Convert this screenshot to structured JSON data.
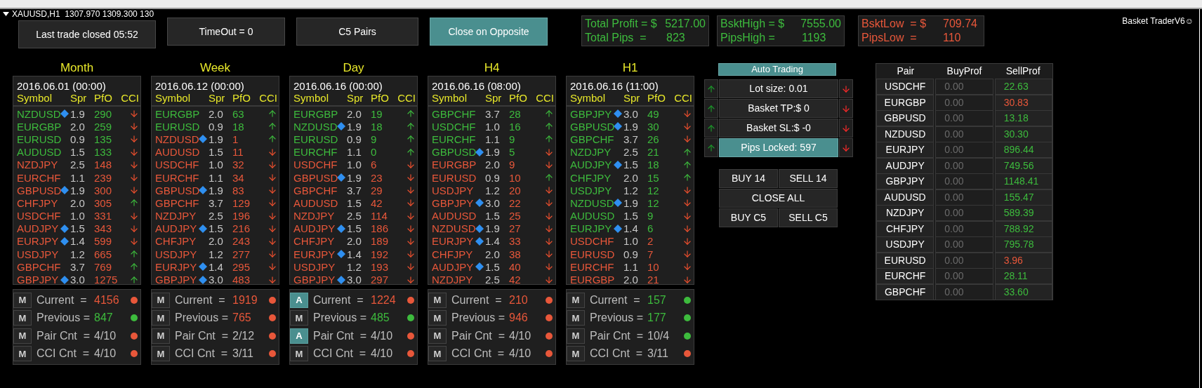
{
  "chart_header": "XAUUSD,H1  1307.970 1309.300 130",
  "top_buttons": [
    {
      "label": "Last trade closed 05:52",
      "selected": false
    },
    {
      "label": "TimeOut = 0",
      "selected": false
    },
    {
      "label": "C5 Pairs",
      "selected": false
    },
    {
      "label": "Close on Opposite",
      "selected": true
    }
  ],
  "summary_boxes": [
    {
      "color": "#3dbb3d",
      "lines": [
        {
          "label": "Total Profit = $",
          "value": "5217.00"
        },
        {
          "label": "Total Pips  =",
          "value": "823"
        }
      ]
    },
    {
      "color": "#3dbb3d",
      "lines": [
        {
          "label": "BsktHigh = $",
          "value": "7555.00"
        },
        {
          "label": "PipsHigh =",
          "value": "1193"
        }
      ]
    },
    {
      "color": "#e8573a",
      "lines": [
        {
          "label": "BsktLow  = $",
          "value": "709.74"
        },
        {
          "label": "PipsLow  =",
          "value": "110"
        }
      ]
    }
  ],
  "brand": "Basket TraderV6☺",
  "panels": [
    {
      "title": "Month",
      "date": "2016.06.01 (00:00)",
      "columns": [
        "Symbol",
        "Spr",
        "PfO",
        "CCI"
      ],
      "rows": [
        {
          "symbol": "NZDUSD",
          "marked": true,
          "spr": "1.9",
          "pfo": "290",
          "cci_up": false,
          "color": "#3dbb3d"
        },
        {
          "symbol": "EURGBP",
          "marked": false,
          "spr": "2.0",
          "pfo": "259",
          "cci_up": false,
          "color": "#3dbb3d"
        },
        {
          "symbol": "EURUSD",
          "marked": false,
          "spr": "0.9",
          "pfo": "135",
          "cci_up": false,
          "color": "#3dbb3d"
        },
        {
          "symbol": "AUDUSD",
          "marked": false,
          "spr": "1.5",
          "pfo": "133",
          "cci_up": false,
          "color": "#3dbb3d"
        },
        {
          "symbol": "NZDJPY",
          "marked": false,
          "spr": "2.5",
          "pfo": "148",
          "cci_up": false,
          "color": "#e8573a"
        },
        {
          "symbol": "EURCHF",
          "marked": false,
          "spr": "1.1",
          "pfo": "239",
          "cci_up": false,
          "color": "#e8573a"
        },
        {
          "symbol": "GBPUSD",
          "marked": true,
          "spr": "1.9",
          "pfo": "300",
          "cci_up": false,
          "color": "#e8573a"
        },
        {
          "symbol": "CHFJPY",
          "marked": false,
          "spr": "2.0",
          "pfo": "305",
          "cci_up": true,
          "color": "#e8573a"
        },
        {
          "symbol": "USDCHF",
          "marked": false,
          "spr": "1.0",
          "pfo": "331",
          "cci_up": false,
          "color": "#e8573a"
        },
        {
          "symbol": "AUDJPY",
          "marked": true,
          "spr": "1.5",
          "pfo": "343",
          "cci_up": false,
          "color": "#e8573a"
        },
        {
          "symbol": "EURJPY",
          "marked": true,
          "spr": "1.4",
          "pfo": "599",
          "cci_up": false,
          "color": "#e8573a"
        },
        {
          "symbol": "USDJPY",
          "marked": false,
          "spr": "1.2",
          "pfo": "665",
          "cci_up": true,
          "color": "#e8573a"
        },
        {
          "symbol": "GBPCHF",
          "marked": false,
          "spr": "3.7",
          "pfo": "769",
          "cci_up": true,
          "color": "#e8573a"
        },
        {
          "symbol": "GBPJPY",
          "marked": true,
          "spr": "3.0",
          "pfo": "1275",
          "cci_up": true,
          "color": "#e8573a"
        }
      ],
      "stats": [
        {
          "mode": "M",
          "active": false,
          "label": "Current  =",
          "value": "4156",
          "value_colored": true,
          "color": "#e8573a"
        },
        {
          "mode": "M",
          "active": false,
          "label": "Previous =",
          "value": "847",
          "value_colored": true,
          "color": "#3dbb3d"
        },
        {
          "mode": "M",
          "active": false,
          "label": "Pair Cnt  =",
          "value": "4/10",
          "value_colored": false,
          "color": "#e8573a"
        },
        {
          "mode": "M",
          "active": false,
          "label": "CCI Cnt  =",
          "value": "4/10",
          "value_colored": false,
          "color": "#e8573a"
        }
      ]
    },
    {
      "title": "Week",
      "date": "2016.06.12 (00:00)",
      "columns": [
        "Symbol",
        "Spr",
        "PfO",
        "CCI"
      ],
      "rows": [
        {
          "symbol": "EURGBP",
          "marked": false,
          "spr": "2.0",
          "pfo": "63",
          "cci_up": true,
          "color": "#3dbb3d"
        },
        {
          "symbol": "EURUSD",
          "marked": false,
          "spr": "0.9",
          "pfo": "18",
          "cci_up": true,
          "color": "#3dbb3d"
        },
        {
          "symbol": "NZDUSD",
          "marked": true,
          "spr": "1.9",
          "pfo": "1",
          "cci_up": true,
          "color": "#e8573a"
        },
        {
          "symbol": "AUDUSD",
          "marked": false,
          "spr": "1.5",
          "pfo": "11",
          "cci_up": false,
          "color": "#e8573a"
        },
        {
          "symbol": "USDCHF",
          "marked": false,
          "spr": "1.0",
          "pfo": "32",
          "cci_up": false,
          "color": "#e8573a"
        },
        {
          "symbol": "EURCHF",
          "marked": false,
          "spr": "1.1",
          "pfo": "34",
          "cci_up": false,
          "color": "#e8573a"
        },
        {
          "symbol": "GBPUSD",
          "marked": true,
          "spr": "1.9",
          "pfo": "83",
          "cci_up": false,
          "color": "#e8573a"
        },
        {
          "symbol": "GBPCHF",
          "marked": false,
          "spr": "3.7",
          "pfo": "129",
          "cci_up": false,
          "color": "#e8573a"
        },
        {
          "symbol": "NZDJPY",
          "marked": false,
          "spr": "2.5",
          "pfo": "196",
          "cci_up": false,
          "color": "#e8573a"
        },
        {
          "symbol": "AUDJPY",
          "marked": true,
          "spr": "1.5",
          "pfo": "216",
          "cci_up": false,
          "color": "#e8573a"
        },
        {
          "symbol": "CHFJPY",
          "marked": false,
          "spr": "2.0",
          "pfo": "243",
          "cci_up": false,
          "color": "#e8573a"
        },
        {
          "symbol": "USDJPY",
          "marked": false,
          "spr": "1.2",
          "pfo": "277",
          "cci_up": false,
          "color": "#e8573a"
        },
        {
          "symbol": "EURJPY",
          "marked": true,
          "spr": "1.4",
          "pfo": "295",
          "cci_up": false,
          "color": "#e8573a"
        },
        {
          "symbol": "GBPJPY",
          "marked": true,
          "spr": "3.0",
          "pfo": "483",
          "cci_up": false,
          "color": "#e8573a"
        }
      ],
      "stats": [
        {
          "mode": "M",
          "active": false,
          "label": "Current  =",
          "value": "1919",
          "value_colored": true,
          "color": "#e8573a"
        },
        {
          "mode": "M",
          "active": false,
          "label": "Previous =",
          "value": "765",
          "value_colored": true,
          "color": "#e8573a"
        },
        {
          "mode": "M",
          "active": false,
          "label": "Pair Cnt  =",
          "value": "2/12",
          "value_colored": false,
          "color": "#e8573a"
        },
        {
          "mode": "M",
          "active": false,
          "label": "CCI Cnt  =",
          "value": "3/11",
          "value_colored": false,
          "color": "#e8573a"
        }
      ]
    },
    {
      "title": "Day",
      "date": "2016.06.16 (00:00)",
      "columns": [
        "Symbol",
        "Spr",
        "PfO",
        "CCI"
      ],
      "rows": [
        {
          "symbol": "EURGBP",
          "marked": false,
          "spr": "2.0",
          "pfo": "19",
          "cci_up": true,
          "color": "#3dbb3d"
        },
        {
          "symbol": "NZDUSD",
          "marked": true,
          "spr": "1.9",
          "pfo": "18",
          "cci_up": true,
          "color": "#3dbb3d"
        },
        {
          "symbol": "EURUSD",
          "marked": false,
          "spr": "0.9",
          "pfo": "9",
          "cci_up": true,
          "color": "#3dbb3d"
        },
        {
          "symbol": "EURCHF",
          "marked": false,
          "spr": "1.1",
          "pfo": "0",
          "cci_up": true,
          "color": "#3dbb3d"
        },
        {
          "symbol": "USDCHF",
          "marked": false,
          "spr": "1.0",
          "pfo": "6",
          "cci_up": false,
          "color": "#e8573a"
        },
        {
          "symbol": "GBPUSD",
          "marked": true,
          "spr": "1.9",
          "pfo": "23",
          "cci_up": false,
          "color": "#e8573a"
        },
        {
          "symbol": "GBPCHF",
          "marked": false,
          "spr": "3.7",
          "pfo": "29",
          "cci_up": false,
          "color": "#e8573a"
        },
        {
          "symbol": "AUDUSD",
          "marked": false,
          "spr": "1.5",
          "pfo": "42",
          "cci_up": false,
          "color": "#e8573a"
        },
        {
          "symbol": "NZDJPY",
          "marked": false,
          "spr": "2.5",
          "pfo": "114",
          "cci_up": false,
          "color": "#e8573a"
        },
        {
          "symbol": "AUDJPY",
          "marked": true,
          "spr": "1.5",
          "pfo": "186",
          "cci_up": false,
          "color": "#e8573a"
        },
        {
          "symbol": "CHFJPY",
          "marked": false,
          "spr": "2.0",
          "pfo": "189",
          "cci_up": false,
          "color": "#e8573a"
        },
        {
          "symbol": "EURJPY",
          "marked": true,
          "spr": "1.4",
          "pfo": "192",
          "cci_up": false,
          "color": "#e8573a"
        },
        {
          "symbol": "USDJPY",
          "marked": false,
          "spr": "1.2",
          "pfo": "193",
          "cci_up": false,
          "color": "#e8573a"
        },
        {
          "symbol": "GBPJPY",
          "marked": true,
          "spr": "3.0",
          "pfo": "297",
          "cci_up": false,
          "color": "#e8573a"
        }
      ],
      "stats": [
        {
          "mode": "A",
          "active": true,
          "label": "Current  =",
          "value": "1224",
          "value_colored": true,
          "color": "#e8573a"
        },
        {
          "mode": "M",
          "active": false,
          "label": "Previous =",
          "value": "485",
          "value_colored": true,
          "color": "#3dbb3d"
        },
        {
          "mode": "A",
          "active": true,
          "label": "Pair Cnt  =",
          "value": "4/10",
          "value_colored": false,
          "color": "#e8573a"
        },
        {
          "mode": "M",
          "active": false,
          "label": "CCI Cnt  =",
          "value": "4/10",
          "value_colored": false,
          "color": "#e8573a"
        }
      ]
    },
    {
      "title": "H4",
      "date": "2016.06.16 (08:00)",
      "columns": [
        "Symbol",
        "Spr",
        "PfO",
        "CCI"
      ],
      "rows": [
        {
          "symbol": "GBPCHF",
          "marked": false,
          "spr": "3.7",
          "pfo": "28",
          "cci_up": true,
          "color": "#3dbb3d"
        },
        {
          "symbol": "USDCHF",
          "marked": false,
          "spr": "1.0",
          "pfo": "16",
          "cci_up": true,
          "color": "#3dbb3d"
        },
        {
          "symbol": "EURCHF",
          "marked": false,
          "spr": "1.1",
          "pfo": "9",
          "cci_up": true,
          "color": "#3dbb3d"
        },
        {
          "symbol": "GBPUSD",
          "marked": true,
          "spr": "1.9",
          "pfo": "5",
          "cci_up": false,
          "color": "#3dbb3d"
        },
        {
          "symbol": "EURGBP",
          "marked": false,
          "spr": "2.0",
          "pfo": "9",
          "cci_up": false,
          "color": "#e8573a"
        },
        {
          "symbol": "EURUSD",
          "marked": false,
          "spr": "0.9",
          "pfo": "10",
          "cci_up": true,
          "color": "#e8573a"
        },
        {
          "symbol": "USDJPY",
          "marked": false,
          "spr": "1.2",
          "pfo": "20",
          "cci_up": false,
          "color": "#e8573a"
        },
        {
          "symbol": "GBPJPY",
          "marked": true,
          "spr": "3.0",
          "pfo": "22",
          "cci_up": false,
          "color": "#e8573a"
        },
        {
          "symbol": "AUDUSD",
          "marked": false,
          "spr": "1.5",
          "pfo": "25",
          "cci_up": false,
          "color": "#e8573a"
        },
        {
          "symbol": "NZDUSD",
          "marked": true,
          "spr": "1.9",
          "pfo": "27",
          "cci_up": false,
          "color": "#e8573a"
        },
        {
          "symbol": "EURJPY",
          "marked": true,
          "spr": "1.4",
          "pfo": "33",
          "cci_up": false,
          "color": "#e8573a"
        },
        {
          "symbol": "CHFJPY",
          "marked": false,
          "spr": "2.0",
          "pfo": "38",
          "cci_up": false,
          "color": "#e8573a"
        },
        {
          "symbol": "AUDJPY",
          "marked": true,
          "spr": "1.5",
          "pfo": "40",
          "cci_up": false,
          "color": "#e8573a"
        },
        {
          "symbol": "NZDJPY",
          "marked": false,
          "spr": "2.5",
          "pfo": "42",
          "cci_up": false,
          "color": "#e8573a"
        }
      ],
      "stats": [
        {
          "mode": "M",
          "active": false,
          "label": "Current  =",
          "value": "210",
          "value_colored": true,
          "color": "#e8573a"
        },
        {
          "mode": "M",
          "active": false,
          "label": "Previous =",
          "value": "946",
          "value_colored": true,
          "color": "#e8573a"
        },
        {
          "mode": "M",
          "active": false,
          "label": "Pair Cnt  =",
          "value": "4/10",
          "value_colored": false,
          "color": "#e8573a"
        },
        {
          "mode": "M",
          "active": false,
          "label": "CCI Cnt  =",
          "value": "4/10",
          "value_colored": false,
          "color": "#e8573a"
        }
      ]
    },
    {
      "title": "H1",
      "date": "2016.06.16 (11:00)",
      "columns": [
        "Symbol",
        "Spr",
        "PfO",
        "CCI"
      ],
      "rows": [
        {
          "symbol": "GBPJPY",
          "marked": true,
          "spr": "3.0",
          "pfo": "49",
          "cci_up": false,
          "color": "#3dbb3d"
        },
        {
          "symbol": "GBPUSD",
          "marked": true,
          "spr": "1.9",
          "pfo": "30",
          "cci_up": false,
          "color": "#3dbb3d"
        },
        {
          "symbol": "GBPCHF",
          "marked": false,
          "spr": "3.7",
          "pfo": "26",
          "cci_up": false,
          "color": "#3dbb3d"
        },
        {
          "symbol": "NZDJPY",
          "marked": false,
          "spr": "2.5",
          "pfo": "21",
          "cci_up": true,
          "color": "#3dbb3d"
        },
        {
          "symbol": "AUDJPY",
          "marked": true,
          "spr": "1.5",
          "pfo": "18",
          "cci_up": true,
          "color": "#3dbb3d"
        },
        {
          "symbol": "CHFJPY",
          "marked": false,
          "spr": "2.0",
          "pfo": "15",
          "cci_up": true,
          "color": "#3dbb3d"
        },
        {
          "symbol": "USDJPY",
          "marked": false,
          "spr": "1.2",
          "pfo": "12",
          "cci_up": false,
          "color": "#3dbb3d"
        },
        {
          "symbol": "NZDUSD",
          "marked": true,
          "spr": "1.9",
          "pfo": "12",
          "cci_up": false,
          "color": "#3dbb3d"
        },
        {
          "symbol": "AUDUSD",
          "marked": false,
          "spr": "1.5",
          "pfo": "9",
          "cci_up": false,
          "color": "#3dbb3d"
        },
        {
          "symbol": "EURJPY",
          "marked": true,
          "spr": "1.4",
          "pfo": "6",
          "cci_up": false,
          "color": "#3dbb3d"
        },
        {
          "symbol": "USDCHF",
          "marked": false,
          "spr": "1.0",
          "pfo": "2",
          "cci_up": false,
          "color": "#e8573a"
        },
        {
          "symbol": "EURUSD",
          "marked": false,
          "spr": "0.9",
          "pfo": "7",
          "cci_up": false,
          "color": "#e8573a"
        },
        {
          "symbol": "EURCHF",
          "marked": false,
          "spr": "1.1",
          "pfo": "10",
          "cci_up": false,
          "color": "#e8573a"
        },
        {
          "symbol": "EURGBP",
          "marked": false,
          "spr": "2.0",
          "pfo": "21",
          "cci_up": false,
          "color": "#e8573a"
        }
      ],
      "stats": [
        {
          "mode": "M",
          "active": false,
          "label": "Current  =",
          "value": "157",
          "value_colored": true,
          "color": "#3dbb3d"
        },
        {
          "mode": "M",
          "active": false,
          "label": "Previous =",
          "value": "177",
          "value_colored": true,
          "color": "#3dbb3d"
        },
        {
          "mode": "M",
          "active": false,
          "label": "Pair Cnt  =",
          "value": "10/4",
          "value_colored": false,
          "color": "#3dbb3d"
        },
        {
          "mode": "M",
          "active": false,
          "label": "CCI Cnt  =",
          "value": "3/11",
          "value_colored": false,
          "color": "#e8573a"
        }
      ]
    }
  ],
  "auto_trading": {
    "label": "Auto Trading",
    "on": true
  },
  "adjusters": [
    {
      "label": "Lot size: 0.01",
      "highlighted": false
    },
    {
      "label": "Basket TP:$ 0",
      "highlighted": false
    },
    {
      "label": "Basket SL:$ -0",
      "highlighted": false
    },
    {
      "label": "Pips Locked: 597",
      "highlighted": true
    }
  ],
  "trade_buttons": [
    [
      "BUY 14",
      "SELL 14"
    ],
    [
      "CLOSE ALL"
    ],
    [
      "BUY C5",
      "SELL C5"
    ]
  ],
  "pair_table": {
    "columns": [
      "Pair",
      "BuyProf",
      "SellProf"
    ],
    "rows": [
      {
        "pair": "USDCHF",
        "buy": "0.00",
        "sell": "22.63",
        "color": "#3dbb3d"
      },
      {
        "pair": "EURGBP",
        "buy": "0.00",
        "sell": "30.83",
        "color": "#e8573a"
      },
      {
        "pair": "GBPUSD",
        "buy": "0.00",
        "sell": "13.18",
        "color": "#3dbb3d"
      },
      {
        "pair": "NZDUSD",
        "buy": "0.00",
        "sell": "30.30",
        "color": "#3dbb3d"
      },
      {
        "pair": "EURJPY",
        "buy": "0.00",
        "sell": "896.44",
        "color": "#3dbb3d"
      },
      {
        "pair": "AUDJPY",
        "buy": "0.00",
        "sell": "749.56",
        "color": "#3dbb3d"
      },
      {
        "pair": "GBPJPY",
        "buy": "0.00",
        "sell": "1148.41",
        "color": "#3dbb3d"
      },
      {
        "pair": "AUDUSD",
        "buy": "0.00",
        "sell": "155.47",
        "color": "#3dbb3d"
      },
      {
        "pair": "NZDJPY",
        "buy": "0.00",
        "sell": "589.39",
        "color": "#3dbb3d"
      },
      {
        "pair": "CHFJPY",
        "buy": "0.00",
        "sell": "788.92",
        "color": "#3dbb3d"
      },
      {
        "pair": "USDJPY",
        "buy": "0.00",
        "sell": "795.78",
        "color": "#3dbb3d"
      },
      {
        "pair": "EURUSD",
        "buy": "0.00",
        "sell": "3.96",
        "color": "#e8573a"
      },
      {
        "pair": "EURCHF",
        "buy": "0.00",
        "sell": "28.11",
        "color": "#3dbb3d"
      },
      {
        "pair": "GBPCHF",
        "buy": "0.00",
        "sell": "33.60",
        "color": "#3dbb3d"
      }
    ]
  }
}
